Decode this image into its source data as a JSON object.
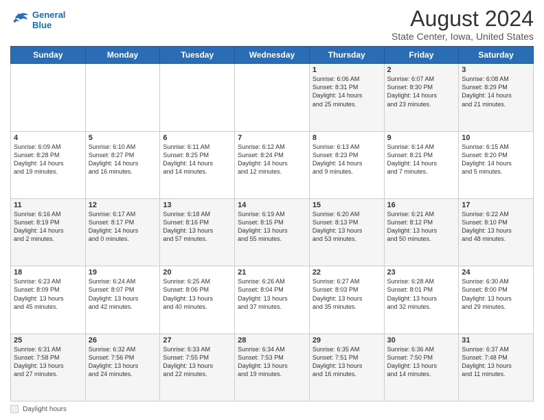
{
  "header": {
    "logo_line1": "General",
    "logo_line2": "Blue",
    "main_title": "August 2024",
    "sub_title": "State Center, Iowa, United States"
  },
  "days_of_week": [
    "Sunday",
    "Monday",
    "Tuesday",
    "Wednesday",
    "Thursday",
    "Friday",
    "Saturday"
  ],
  "footer": {
    "legend_label": "Daylight hours"
  },
  "weeks": [
    [
      {
        "day": "",
        "info": ""
      },
      {
        "day": "",
        "info": ""
      },
      {
        "day": "",
        "info": ""
      },
      {
        "day": "",
        "info": ""
      },
      {
        "day": "1",
        "info": "Sunrise: 6:06 AM\nSunset: 8:31 PM\nDaylight: 14 hours\nand 25 minutes."
      },
      {
        "day": "2",
        "info": "Sunrise: 6:07 AM\nSunset: 8:30 PM\nDaylight: 14 hours\nand 23 minutes."
      },
      {
        "day": "3",
        "info": "Sunrise: 6:08 AM\nSunset: 8:29 PM\nDaylight: 14 hours\nand 21 minutes."
      }
    ],
    [
      {
        "day": "4",
        "info": "Sunrise: 6:09 AM\nSunset: 8:28 PM\nDaylight: 14 hours\nand 19 minutes."
      },
      {
        "day": "5",
        "info": "Sunrise: 6:10 AM\nSunset: 8:27 PM\nDaylight: 14 hours\nand 16 minutes."
      },
      {
        "day": "6",
        "info": "Sunrise: 6:11 AM\nSunset: 8:25 PM\nDaylight: 14 hours\nand 14 minutes."
      },
      {
        "day": "7",
        "info": "Sunrise: 6:12 AM\nSunset: 8:24 PM\nDaylight: 14 hours\nand 12 minutes."
      },
      {
        "day": "8",
        "info": "Sunrise: 6:13 AM\nSunset: 8:23 PM\nDaylight: 14 hours\nand 9 minutes."
      },
      {
        "day": "9",
        "info": "Sunrise: 6:14 AM\nSunset: 8:21 PM\nDaylight: 14 hours\nand 7 minutes."
      },
      {
        "day": "10",
        "info": "Sunrise: 6:15 AM\nSunset: 8:20 PM\nDaylight: 14 hours\nand 5 minutes."
      }
    ],
    [
      {
        "day": "11",
        "info": "Sunrise: 6:16 AM\nSunset: 8:19 PM\nDaylight: 14 hours\nand 2 minutes."
      },
      {
        "day": "12",
        "info": "Sunrise: 6:17 AM\nSunset: 8:17 PM\nDaylight: 14 hours\nand 0 minutes."
      },
      {
        "day": "13",
        "info": "Sunrise: 6:18 AM\nSunset: 8:16 PM\nDaylight: 13 hours\nand 57 minutes."
      },
      {
        "day": "14",
        "info": "Sunrise: 6:19 AM\nSunset: 8:15 PM\nDaylight: 13 hours\nand 55 minutes."
      },
      {
        "day": "15",
        "info": "Sunrise: 6:20 AM\nSunset: 8:13 PM\nDaylight: 13 hours\nand 53 minutes."
      },
      {
        "day": "16",
        "info": "Sunrise: 6:21 AM\nSunset: 8:12 PM\nDaylight: 13 hours\nand 50 minutes."
      },
      {
        "day": "17",
        "info": "Sunrise: 6:22 AM\nSunset: 8:10 PM\nDaylight: 13 hours\nand 48 minutes."
      }
    ],
    [
      {
        "day": "18",
        "info": "Sunrise: 6:23 AM\nSunset: 8:09 PM\nDaylight: 13 hours\nand 45 minutes."
      },
      {
        "day": "19",
        "info": "Sunrise: 6:24 AM\nSunset: 8:07 PM\nDaylight: 13 hours\nand 42 minutes."
      },
      {
        "day": "20",
        "info": "Sunrise: 6:25 AM\nSunset: 8:06 PM\nDaylight: 13 hours\nand 40 minutes."
      },
      {
        "day": "21",
        "info": "Sunrise: 6:26 AM\nSunset: 8:04 PM\nDaylight: 13 hours\nand 37 minutes."
      },
      {
        "day": "22",
        "info": "Sunrise: 6:27 AM\nSunset: 8:03 PM\nDaylight: 13 hours\nand 35 minutes."
      },
      {
        "day": "23",
        "info": "Sunrise: 6:28 AM\nSunset: 8:01 PM\nDaylight: 13 hours\nand 32 minutes."
      },
      {
        "day": "24",
        "info": "Sunrise: 6:30 AM\nSunset: 8:00 PM\nDaylight: 13 hours\nand 29 minutes."
      }
    ],
    [
      {
        "day": "25",
        "info": "Sunrise: 6:31 AM\nSunset: 7:58 PM\nDaylight: 13 hours\nand 27 minutes."
      },
      {
        "day": "26",
        "info": "Sunrise: 6:32 AM\nSunset: 7:56 PM\nDaylight: 13 hours\nand 24 minutes."
      },
      {
        "day": "27",
        "info": "Sunrise: 6:33 AM\nSunset: 7:55 PM\nDaylight: 13 hours\nand 22 minutes."
      },
      {
        "day": "28",
        "info": "Sunrise: 6:34 AM\nSunset: 7:53 PM\nDaylight: 13 hours\nand 19 minutes."
      },
      {
        "day": "29",
        "info": "Sunrise: 6:35 AM\nSunset: 7:51 PM\nDaylight: 13 hours\nand 16 minutes."
      },
      {
        "day": "30",
        "info": "Sunrise: 6:36 AM\nSunset: 7:50 PM\nDaylight: 13 hours\nand 14 minutes."
      },
      {
        "day": "31",
        "info": "Sunrise: 6:37 AM\nSunset: 7:48 PM\nDaylight: 13 hours\nand 11 minutes."
      }
    ]
  ]
}
